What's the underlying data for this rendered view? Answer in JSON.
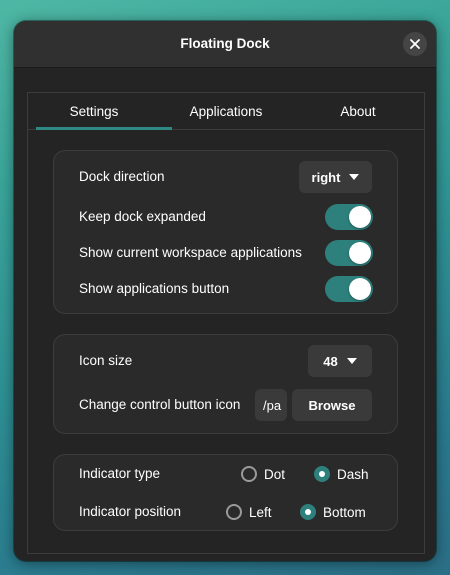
{
  "window": {
    "title": "Floating Dock"
  },
  "tabs": [
    {
      "label": "Settings",
      "active": true
    },
    {
      "label": "Applications",
      "active": false
    },
    {
      "label": "About",
      "active": false
    }
  ],
  "general": {
    "dock_direction": {
      "label": "Dock direction",
      "value": "right"
    },
    "keep_expanded": {
      "label": "Keep dock expanded",
      "on": true
    },
    "show_workspace_apps": {
      "label": "Show current workspace applications",
      "on": true
    },
    "show_apps_button": {
      "label": "Show applications button",
      "on": true
    }
  },
  "icons": {
    "icon_size": {
      "label": "Icon size",
      "value": "48"
    },
    "control_icon": {
      "label": "Change control button icon",
      "path_value": "/pa",
      "browse_label": "Browse"
    }
  },
  "indicator": {
    "type": {
      "label": "Indicator type",
      "options": [
        "Dot",
        "Dash"
      ],
      "selected": "Dash"
    },
    "position": {
      "label": "Indicator position",
      "options": [
        "Left",
        "Bottom"
      ],
      "selected": "Bottom"
    }
  },
  "colors": {
    "accent": "#2d807c",
    "window_bg": "#242424",
    "headerbar_bg": "#303030",
    "panel_bg": "#2a2a2a"
  }
}
